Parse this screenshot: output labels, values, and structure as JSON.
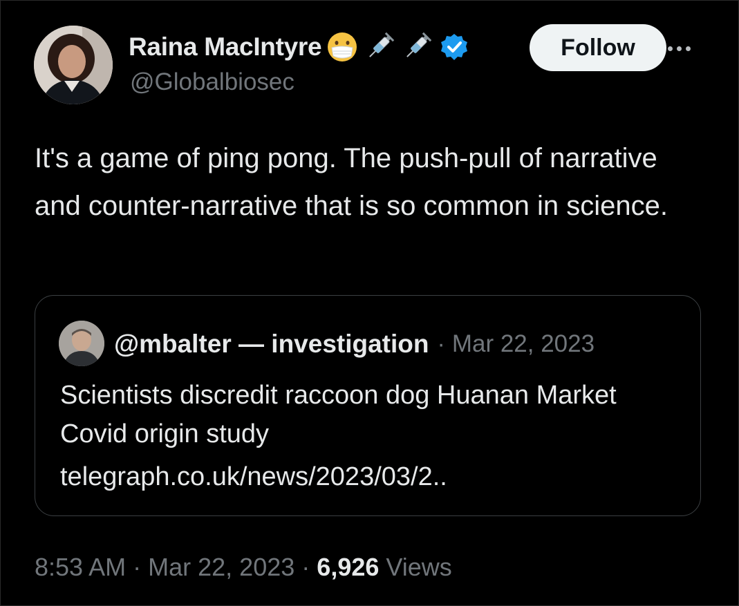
{
  "author": {
    "name": "Raina MacIntyre",
    "handle": "@Globalbiosec",
    "emoji_icons": [
      "mask-face-icon",
      "syringe-icon",
      "syringe-icon",
      "verified-badge-icon"
    ]
  },
  "follow_button": {
    "label": "Follow"
  },
  "tweet": {
    "text": "It's a game of ping pong. The push-pull of narrative and counter-narrative that is so common in science."
  },
  "quote": {
    "user": "@mbalter — investigation",
    "separator": "·",
    "date": "Mar 22, 2023",
    "text": "Scientists discredit raccoon dog Huanan Market Covid origin study",
    "link": "telegraph.co.uk/news/2023/03/2.."
  },
  "meta": {
    "time": "8:53 AM",
    "separator": "·",
    "date": "Mar 22, 2023",
    "separator2": "·",
    "views_count": "6,926",
    "views_label": "Views"
  },
  "colors": {
    "background": "#000000",
    "text": "#e7e9ea",
    "muted": "#71767b",
    "verified": "#1d9bf0",
    "follow_bg": "#eff3f4"
  }
}
